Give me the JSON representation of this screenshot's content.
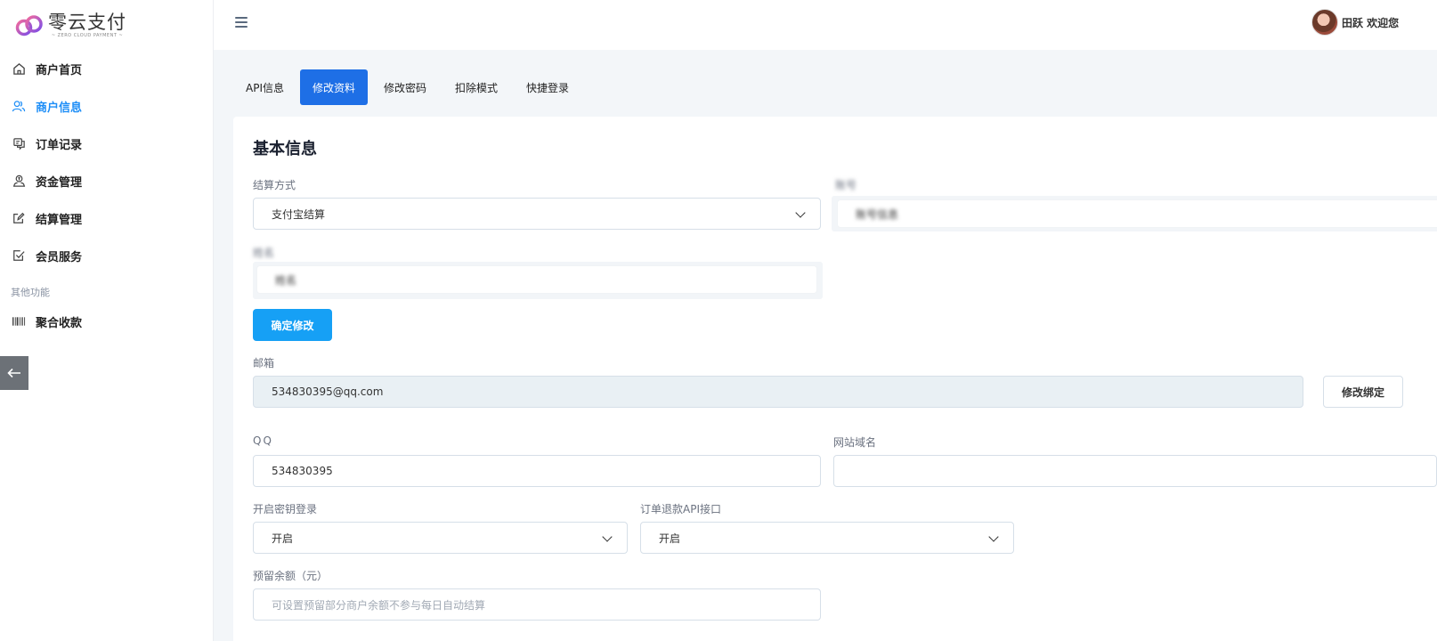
{
  "brand": {
    "name": "零云支付",
    "tagline": "~ ZERO CLOUD PAYMENT ~",
    "colors": {
      "primary": "#1e6fe6",
      "accent": "#16a0f5",
      "active_nav": "#1e8ef7"
    }
  },
  "sidebar": {
    "items": [
      {
        "label": "商户首页",
        "icon": "home-icon"
      },
      {
        "label": "商户信息",
        "icon": "users-icon",
        "active": true
      },
      {
        "label": "订单记录",
        "icon": "chat-list-icon"
      },
      {
        "label": "资金管理",
        "icon": "money-user-icon"
      },
      {
        "label": "结算管理",
        "icon": "edit-icon"
      },
      {
        "label": "会员服务",
        "icon": "checkbox-icon"
      }
    ],
    "section_label": "其他功能",
    "extra_items": [
      {
        "label": "聚合收款",
        "icon": "barcode-icon"
      }
    ]
  },
  "header": {
    "user_name": "田跃 欢迎您"
  },
  "tabs": [
    {
      "label": "API信息"
    },
    {
      "label": "修改资料",
      "active": true
    },
    {
      "label": "修改密码"
    },
    {
      "label": "扣除模式"
    },
    {
      "label": "快捷登录"
    }
  ],
  "form": {
    "title": "基本信息",
    "settle_method": {
      "label": "结算方式",
      "value": "支付宝结算"
    },
    "account": {
      "label": "账号",
      "value": "账号信息"
    },
    "name": {
      "label": "姓名",
      "value": "姓名"
    },
    "confirm_button": "确定修改",
    "email": {
      "label": "邮箱",
      "value": "534830395@qq.com",
      "button": "修改绑定"
    },
    "qq": {
      "label": "QQ",
      "value": "534830395"
    },
    "domain": {
      "label": "网站域名",
      "value": ""
    },
    "key_login": {
      "label": "开启密钥登录",
      "value": "开启"
    },
    "refund_api": {
      "label": "订单退款API接口",
      "value": "开启"
    },
    "reserve": {
      "label": "预留余额（元）",
      "placeholder": "可设置预留部分商户余额不参与每日自动结算"
    }
  }
}
